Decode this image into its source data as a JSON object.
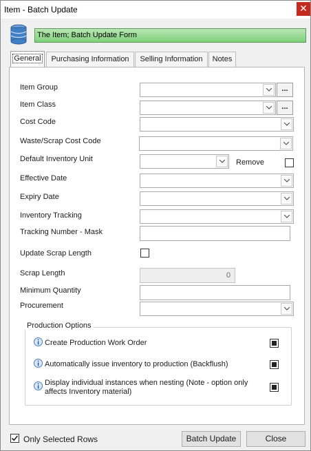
{
  "window": {
    "title": "Item - Batch Update",
    "close_glyph": "✕"
  },
  "header": {
    "text": "The Item; Batch Update Form",
    "icon": "database-icon"
  },
  "tabs": [
    "General",
    "Purchasing Information",
    "Selling Information",
    "Notes"
  ],
  "fields": {
    "item_group": {
      "label": "Item Group",
      "value": ""
    },
    "item_class": {
      "label": "Item Class",
      "value": ""
    },
    "cost_code": {
      "label": "Cost Code",
      "value": ""
    },
    "waste_scrap_cost_code": {
      "label": "Waste/Scrap Cost Code",
      "value": ""
    },
    "default_inventory_unit": {
      "label": "Default Inventory Unit",
      "value": ""
    },
    "remove_label": "Remove",
    "effective_date": {
      "label": "Effective Date",
      "value": ""
    },
    "expiry_date": {
      "label": "Expiry Date",
      "value": ""
    },
    "inventory_tracking": {
      "label": "Inventory Tracking",
      "value": ""
    },
    "tracking_number_mask": {
      "label": "Tracking Number - Mask",
      "value": ""
    },
    "update_scrap_length": {
      "label": "Update Scrap Length",
      "checked": false
    },
    "scrap_length": {
      "label": "Scrap Length",
      "value": "0"
    },
    "minimum_quantity": {
      "label": "Minimum Quantity",
      "value": ""
    },
    "procurement": {
      "label": "Procurement",
      "value": ""
    },
    "ellipsis": "..."
  },
  "production_options": {
    "title": "Production Options",
    "items": [
      {
        "label": "Create Production Work Order",
        "state": "indeterminate"
      },
      {
        "label": "Automatically issue inventory to production (Backflush)",
        "state": "indeterminate"
      },
      {
        "label_line1": "Display individual instances when nesting (Note - option only",
        "label_line2": "affects Inventory material)",
        "state": "indeterminate"
      }
    ]
  },
  "footer": {
    "only_selected_rows": {
      "label": "Only Selected Rows",
      "checked": true
    },
    "batch_update": "Batch Update",
    "close": "Close"
  }
}
